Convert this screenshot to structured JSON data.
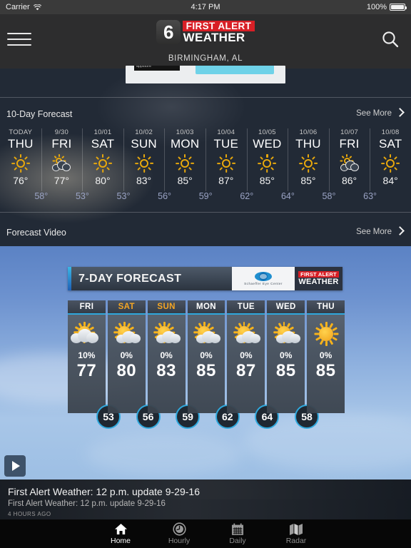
{
  "status_bar": {
    "carrier": "Carrier",
    "wifi_icon": "wifi-icon",
    "time": "4:17 PM",
    "battery_percent": "100%",
    "battery_icon": "battery-full-icon"
  },
  "header": {
    "menu_icon": "hamburger-menu-icon",
    "search_icon": "search-icon",
    "logo": {
      "channel_number": "6",
      "line1": "FIRST ALERT",
      "line2": "WEATHER",
      "red": "#d81f26"
    },
    "location": "BIRMINGHAM, AL"
  },
  "promo_card": {
    "chip_text": "appstore",
    "button_color": "#6fd2e8"
  },
  "ten_day": {
    "title": "10-Day Forecast",
    "see_more": "See More",
    "chevron_icon": "chevron-right-icon",
    "days": [
      {
        "date": "TODAY",
        "dow": "THU",
        "icon": "sunny-icon",
        "high": "76°",
        "low": "58°"
      },
      {
        "date": "9/30",
        "dow": "FRI",
        "icon": "partly-cloudy-icon",
        "high": "77°",
        "low": "53°"
      },
      {
        "date": "10/01",
        "dow": "SAT",
        "icon": "sunny-icon",
        "high": "80°",
        "low": "53°"
      },
      {
        "date": "10/02",
        "dow": "SUN",
        "icon": "sunny-icon",
        "high": "83°",
        "low": "56°"
      },
      {
        "date": "10/03",
        "dow": "MON",
        "icon": "sunny-icon",
        "high": "85°",
        "low": "59°"
      },
      {
        "date": "10/04",
        "dow": "TUE",
        "icon": "sunny-icon",
        "high": "87°",
        "low": "62°"
      },
      {
        "date": "10/05",
        "dow": "WED",
        "icon": "sunny-icon",
        "high": "85°",
        "low": "64°"
      },
      {
        "date": "10/06",
        "dow": "THU",
        "icon": "sunny-icon",
        "high": "85°",
        "low": "58°"
      },
      {
        "date": "10/07",
        "dow": "FRI",
        "icon": "partly-cloudy-icon",
        "high": "86°",
        "low": "63°"
      },
      {
        "date": "10/08",
        "dow": "SAT",
        "icon": "sunny-icon",
        "high": "84°",
        "low": ""
      }
    ]
  },
  "forecast_video": {
    "title": "Forecast Video",
    "see_more": "See More",
    "chevron_icon": "chevron-right-icon",
    "play_icon": "play-icon",
    "graphic": {
      "headline": "7-DAY FORECAST",
      "sponsor": "Schaeffer Eye Center",
      "brand_line1": "FIRST ALERT",
      "brand_line2": "WEATHER",
      "days": [
        {
          "dow": "FRI",
          "weekend": false,
          "icon": "mostly-cloudy-icon",
          "pop": "10%",
          "high": "77",
          "low": "53"
        },
        {
          "dow": "SAT",
          "weekend": true,
          "icon": "sun-cloud-icon",
          "pop": "0%",
          "high": "80",
          "low": "56"
        },
        {
          "dow": "SUN",
          "weekend": true,
          "icon": "sun-cloud-icon",
          "pop": "0%",
          "high": "83",
          "low": "59"
        },
        {
          "dow": "MON",
          "weekend": false,
          "icon": "sun-cloud-icon",
          "pop": "0%",
          "high": "85",
          "low": "62"
        },
        {
          "dow": "TUE",
          "weekend": false,
          "icon": "sun-cloud-icon",
          "pop": "0%",
          "high": "87",
          "low": "64"
        },
        {
          "dow": "WED",
          "weekend": false,
          "icon": "sun-cloud-icon",
          "pop": "0%",
          "high": "85",
          "low": "58"
        },
        {
          "dow": "THU",
          "weekend": false,
          "icon": "sunny-icon",
          "pop": "0%",
          "high": "85",
          "low": ""
        }
      ]
    },
    "meta": {
      "title": "First Alert Weather: 12 p.m. update 9-29-16",
      "subtitle": "First Alert Weather: 12 p.m. update 9-29-16",
      "age": "4 HOURS AGO"
    }
  },
  "tab_bar": {
    "tabs": [
      {
        "label": "Home",
        "icon": "home-icon",
        "active": true
      },
      {
        "label": "Hourly",
        "icon": "clock-icon",
        "active": false
      },
      {
        "label": "Daily",
        "icon": "calendar-icon",
        "active": false
      },
      {
        "label": "Radar",
        "icon": "map-icon",
        "active": false
      }
    ]
  }
}
